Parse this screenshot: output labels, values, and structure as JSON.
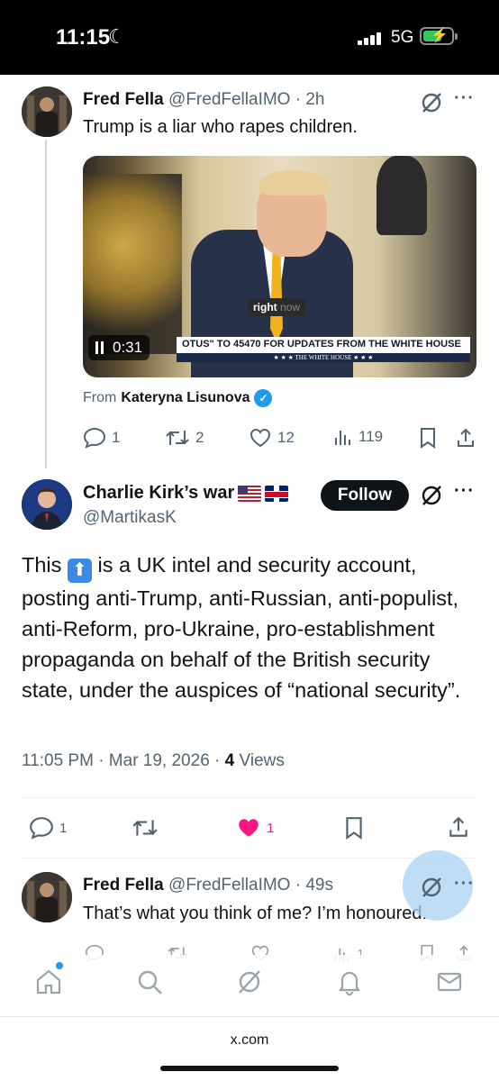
{
  "status_bar": {
    "time": "11:15",
    "moon_glyph": "☾",
    "network": "5G",
    "battery_color": "#34c759"
  },
  "tweet1": {
    "name": "Fred Fella",
    "handle": "@FredFellaIMO",
    "time": "· 2h",
    "text": "Trump is a liar who rapes children.",
    "video": {
      "badge_main": "right",
      "badge_sub": "now",
      "chyron": "OTUS\" TO 45470 FOR UPDATES FROM THE WHITE HOUSE",
      "chyron_sub": "★ ★ ★  THE WHITE HOUSE  ★ ★ ★",
      "duration": "0:31"
    },
    "from_prefix": "From",
    "from_name": "Kateryna Lisunova",
    "actions": {
      "replies": "1",
      "reposts": "2",
      "likes": "12",
      "views": "119"
    }
  },
  "tweet2": {
    "name": "Charlie Kirk’s war",
    "handle": "@MartikasK",
    "follow_label": "Follow",
    "body_prefix": "This",
    "up_emoji": "⬆",
    "body_rest": "is a UK intel and security account, posting anti-Trump, anti-Russian, anti-populist, anti-Reform, pro-Ukraine, pro-establishment propaganda on behalf of the British security state, under the auspices of “national security”.",
    "timestamp": "11:05 PM · Mar 19, 2026 ·",
    "views_count": "4",
    "views_label": "Views",
    "actions": {
      "replies": "1",
      "likes": "1"
    },
    "like_color": "#f91880"
  },
  "tweet3": {
    "name": "Fred Fella",
    "handle": "@FredFellaIMO",
    "time": "· 49s",
    "text": "That’s what you think of me? I’m honoured.",
    "actions": {
      "views": "1"
    }
  },
  "browser": {
    "url": "x.com"
  },
  "colors": {
    "accent": "#1d9bf0",
    "text": "#0f1419",
    "muted": "#536471"
  }
}
